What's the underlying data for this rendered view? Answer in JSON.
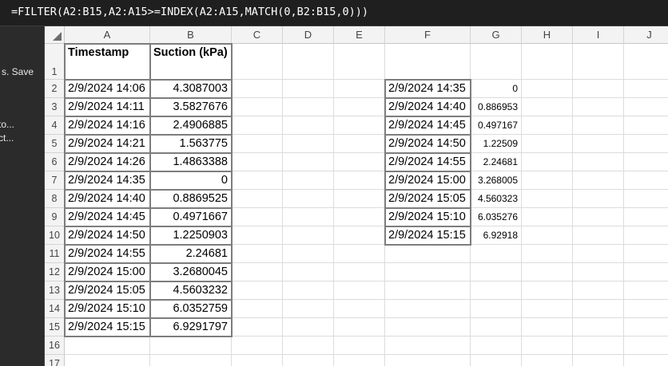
{
  "formula_bar": {
    "formula": "=FILTER(A2:B15,A2:A15>=INDEX(A2:A15,MATCH(0,B2:B15,0)))"
  },
  "left_pane": {
    "items": [
      {
        "label": "s. Save"
      },
      {
        "label": "to..."
      },
      {
        "label": "ct..."
      }
    ]
  },
  "sheet": {
    "columns": [
      "A",
      "B",
      "C",
      "D",
      "E",
      "F",
      "G",
      "H",
      "I",
      "J"
    ],
    "rows": [
      "1",
      "2",
      "3",
      "4",
      "5",
      "6",
      "7",
      "8",
      "9",
      "10",
      "11",
      "12",
      "13",
      "14",
      "15",
      "16",
      "17"
    ],
    "headers": {
      "A": "Timestamp",
      "B": "Suction (kPa)"
    },
    "source_table": [
      [
        "2/9/2024 14:06",
        "4.3087003"
      ],
      [
        "2/9/2024 14:11",
        "3.5827676"
      ],
      [
        "2/9/2024 14:16",
        "2.4906885"
      ],
      [
        "2/9/2024 14:21",
        "1.563775"
      ],
      [
        "2/9/2024 14:26",
        "1.4863388"
      ],
      [
        "2/9/2024 14:35",
        "0"
      ],
      [
        "2/9/2024 14:40",
        "0.8869525"
      ],
      [
        "2/9/2024 14:45",
        "0.4971667"
      ],
      [
        "2/9/2024 14:50",
        "1.2250903"
      ],
      [
        "2/9/2024 14:55",
        "2.24681"
      ],
      [
        "2/9/2024 15:00",
        "3.2680045"
      ],
      [
        "2/9/2024 15:05",
        "4.5603232"
      ],
      [
        "2/9/2024 15:10",
        "6.0352759"
      ],
      [
        "2/9/2024 15:15",
        "6.9291797"
      ]
    ],
    "filtered_table": [
      [
        "2/9/2024 14:35",
        "0"
      ],
      [
        "2/9/2024 14:40",
        "0.886953"
      ],
      [
        "2/9/2024 14:45",
        "0.497167"
      ],
      [
        "2/9/2024 14:50",
        "1.22509"
      ],
      [
        "2/9/2024 14:55",
        "2.24681"
      ],
      [
        "2/9/2024 15:00",
        "3.268005"
      ],
      [
        "2/9/2024 15:05",
        "4.560323"
      ],
      [
        "2/9/2024 15:10",
        "6.035276"
      ],
      [
        "2/9/2024 15:15",
        "6.92918"
      ]
    ]
  }
}
